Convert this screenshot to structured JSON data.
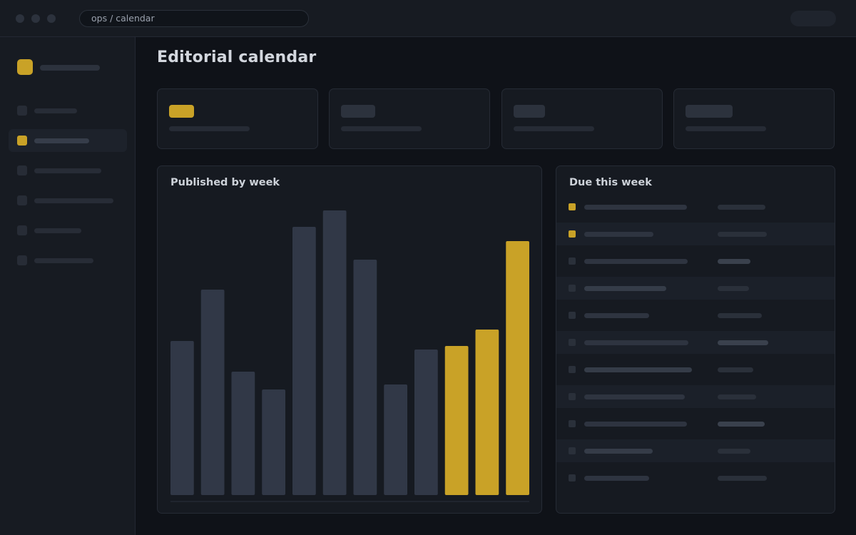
{
  "window": {
    "url": "ops / calendar"
  },
  "page": {
    "title": "Editorial calendar"
  },
  "sidebar": {
    "active_index": 1,
    "items": [
      {
        "name": "nav-item-1"
      },
      {
        "name": "nav-item-2"
      },
      {
        "name": "nav-item-3"
      },
      {
        "name": "nav-item-4"
      },
      {
        "name": "nav-item-5"
      },
      {
        "name": "nav-item-6"
      }
    ]
  },
  "colors": {
    "accent": "#c9a227",
    "bar_default": "#313847",
    "background": "#0f1218",
    "panel": "#161a21"
  },
  "chart_panel": {
    "title": "Published by week"
  },
  "chart_data": {
    "type": "bar",
    "title": "Published by week",
    "categories": [
      "",
      "",
      "",
      "",
      "",
      "",
      "",
      "",
      "",
      "",
      "",
      ""
    ],
    "values": [
      216,
      288,
      173,
      148,
      376,
      399,
      330,
      155,
      204,
      209,
      232,
      356
    ],
    "highlighted": [
      false,
      false,
      false,
      false,
      false,
      false,
      false,
      false,
      false,
      true,
      true,
      true
    ],
    "ylim": [
      0,
      420
    ],
    "grid": false,
    "xlabel": "",
    "ylabel": ""
  },
  "due_panel": {
    "title": "Due this week",
    "rows": [
      {
        "checked": true
      },
      {
        "checked": true
      },
      {
        "checked": false
      },
      {
        "checked": false
      },
      {
        "checked": false
      },
      {
        "checked": false
      },
      {
        "checked": false
      },
      {
        "checked": false
      },
      {
        "checked": false
      },
      {
        "checked": false
      },
      {
        "checked": false
      }
    ]
  }
}
